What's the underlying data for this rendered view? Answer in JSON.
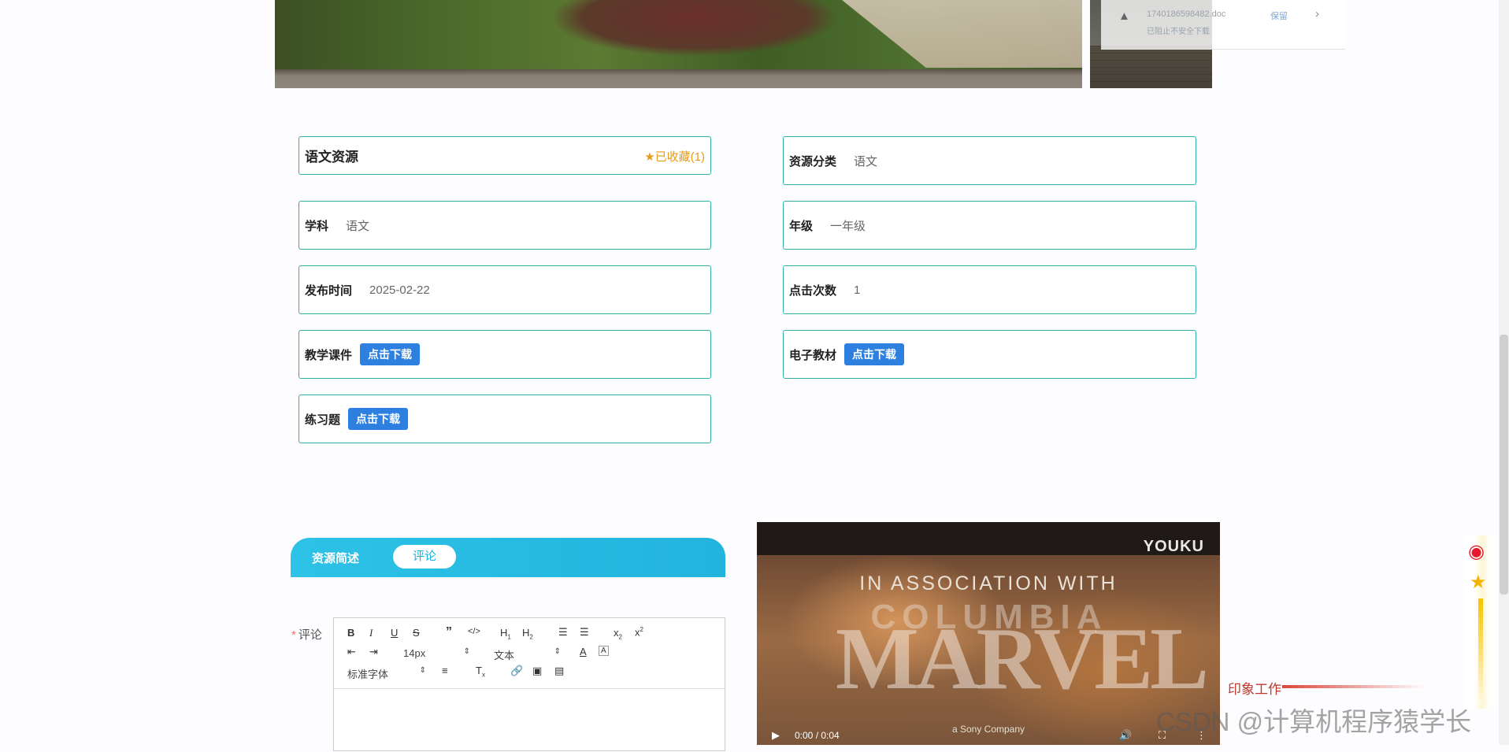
{
  "download_popup": {
    "file_name": "1740186598482.doc",
    "status_text": "已阻止不安全下载",
    "keep_label": "保留",
    "warn_icon": "warning-icon",
    "chevron_icon": "chevron-right-icon"
  },
  "resource": {
    "title": "语文资源",
    "favorite_label": "已收藏(1)",
    "category_label": "资源分类",
    "category_value": "语文",
    "subject_label": "学科",
    "subject_value": "语文",
    "grade_label": "年级",
    "grade_value": "一年级",
    "publish_label": "发布时间",
    "publish_value": "2025-02-22",
    "clicks_label": "点击次数",
    "clicks_value": "1",
    "courseware_label": "教学课件",
    "textbook_label": "电子教材",
    "exercise_label": "练习题",
    "download_label": "点击下载"
  },
  "tabs": {
    "summary_label": "资源简述",
    "comment_label": "评论"
  },
  "comment": {
    "required_mark": "*",
    "label": "评论",
    "font_size": "14px",
    "text_type": "文本",
    "font_family": "标准字体"
  },
  "video": {
    "brand": "YOUKU",
    "line1": "IN ASSOCIATION WITH",
    "columbia": "COLUMBIA",
    "marvel": "MARVEL",
    "sony": "a Sony Company",
    "time": "0:00 / 0:04"
  },
  "overlay": {
    "yinxiang": "印象工作",
    "watermark": "CSDN @计算机程序猿学长"
  },
  "colors": {
    "field_border": "#2fb0a6",
    "download_button": "#2d7fe0",
    "favorite": "#e89b19",
    "tab_bar": "#22b4dd"
  }
}
